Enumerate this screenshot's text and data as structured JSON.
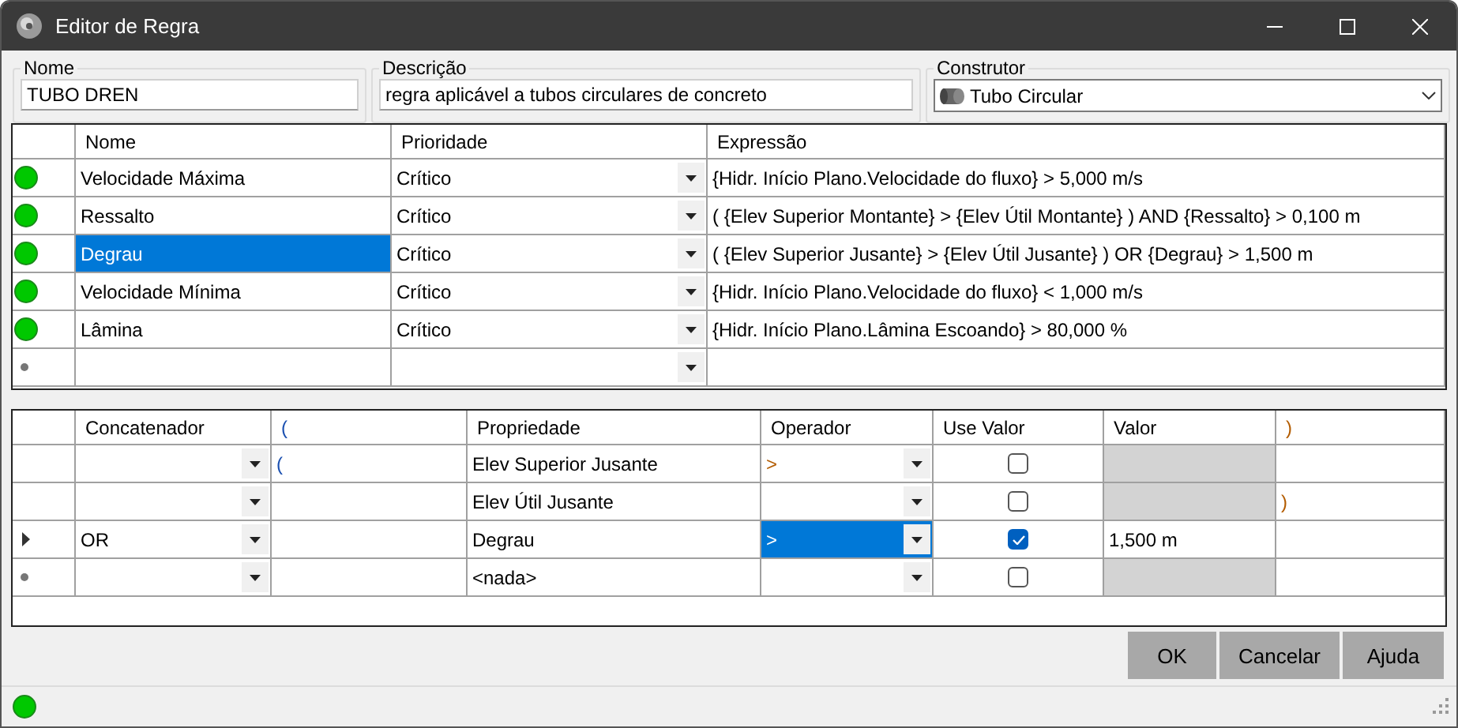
{
  "window": {
    "title": "Editor de Regra"
  },
  "fields": [
    {
      "label": "Nome",
      "value": "TUBO DREN"
    },
    {
      "label": "Descrição",
      "value": "regra aplicável a tubos circulares de concreto"
    }
  ],
  "constructor": {
    "label": "Construtor",
    "value": "Tubo Circular"
  },
  "rules": {
    "columns": [
      "Nome",
      "Prioridade",
      "Expressão"
    ],
    "rows": [
      {
        "kind": "rule",
        "color": "#00c800",
        "name": "Velocidade Máxima",
        "priority": "Crítico",
        "expression": "{Hidr. Início Plano.Velocidade do fluxo} > 5,000 m/s",
        "selected": false
      },
      {
        "kind": "rule",
        "color": "#00c800",
        "name": "Ressalto",
        "priority": "Crítico",
        "expression": "( {Elev Superior Montante} >  {Elev Útil Montante} )  AND {Ressalto} > 0,100 m",
        "selected": false
      },
      {
        "kind": "rule",
        "color": "#00c800",
        "name": "Degrau",
        "priority": "Crítico",
        "expression": "( {Elev Superior Jusante} >  {Elev Útil Jusante} )  OR {Degrau} > 1,500 m",
        "selected": true
      },
      {
        "kind": "rule",
        "color": "#00c800",
        "name": "Velocidade Mínima",
        "priority": "Crítico",
        "expression": "{Hidr. Início Plano.Velocidade do fluxo} < 1,000 m/s",
        "selected": false
      },
      {
        "kind": "rule",
        "color": "#00c800",
        "name": "Lâmina",
        "priority": "Crítico",
        "expression": "{Hidr. Início Plano.Lâmina Escoando} > 80,000 %",
        "selected": false
      },
      {
        "kind": "new"
      }
    ]
  },
  "conditions": {
    "columns": [
      "Concatenador",
      "(",
      "Propriedade",
      "Operador",
      "Use Valor",
      "Valor",
      ")"
    ],
    "rows": [
      {
        "kind": "condition",
        "selected": false,
        "open": "(",
        "property": "Elev Superior Jusante",
        "operator": ">",
        "use_value": false
      },
      {
        "kind": "condition",
        "selected": false,
        "property": "Elev Útil Jusante",
        "use_value": false,
        "close": ")"
      },
      {
        "kind": "condition",
        "selected": true,
        "concatenator": "OR",
        "property": "Degrau",
        "operator": ">",
        "use_value": true,
        "value": "1,500 m"
      },
      {
        "kind": "new",
        "property": "<nada>",
        "use_value": false
      }
    ]
  },
  "buttons": [
    "OK",
    "Cancelar",
    "Ajuda"
  ],
  "status_bar": {
    "color": "#00c800"
  }
}
